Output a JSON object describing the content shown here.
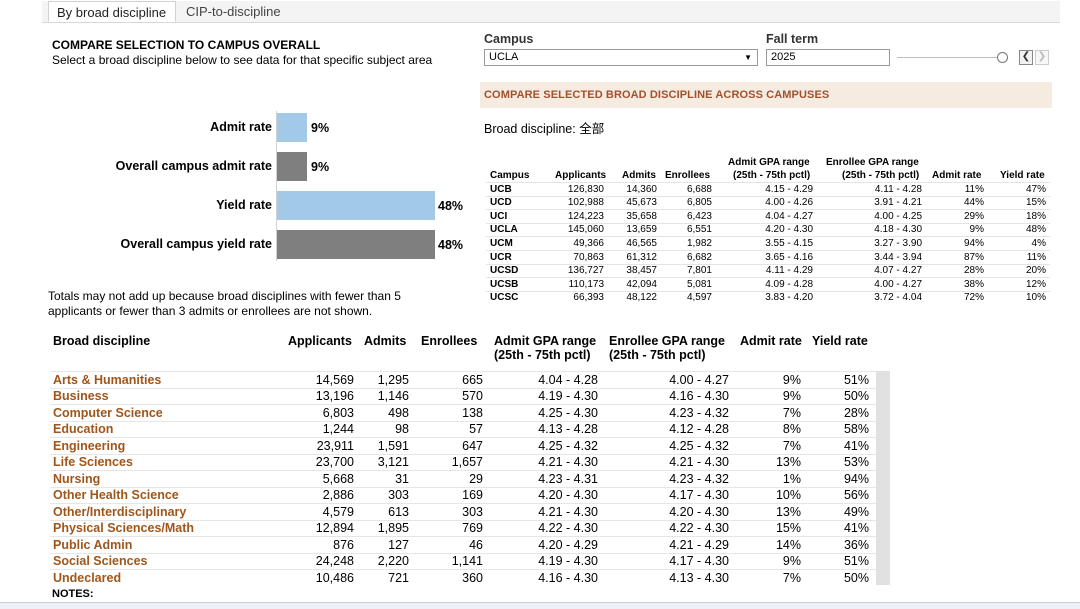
{
  "tabs": [
    {
      "label": "By broad discipline",
      "active": true
    },
    {
      "label": "CIP-to-discipline",
      "active": false
    }
  ],
  "compare": {
    "title": "COMPARE SELECTION TO CAMPUS OVERALL",
    "subtitle": "Select a broad discipline below to see data for that specific subject area",
    "bars": [
      {
        "label": "Admit rate",
        "value": 9,
        "display": "9%",
        "color": "#a3c9e8"
      },
      {
        "label": "Overall campus admit rate",
        "value": 9,
        "display": "9%",
        "color": "#7f7f7f"
      },
      {
        "label": "Yield rate",
        "value": 48,
        "display": "48%",
        "color": "#a3c9e8"
      },
      {
        "label": "Overall campus yield rate",
        "value": 48,
        "display": "48%",
        "color": "#7f7f7f"
      }
    ],
    "note": "Totals may not add up because broad disciplines with fewer than 5 applicants or fewer than 3 admits or enrollees are not shown."
  },
  "filters": {
    "campus_label": "Campus",
    "campus_value": "UCLA",
    "term_label": "Fall term",
    "term_value": "2025"
  },
  "campus_compare": {
    "title": "COMPARE SELECTED BROAD DISCIPLINE ACROSS CAMPUSES",
    "discipline_line": "Broad discipline: 全部",
    "headers": {
      "campus": "Campus",
      "applicants": "Applicants",
      "admits": "Admits",
      "enrollees": "Enrollees",
      "admit_gpa_1": "Admit GPA range",
      "admit_gpa_2": "(25th - 75th pctl)",
      "enrollee_gpa_1": "Enrollee GPA range",
      "enrollee_gpa_2": "(25th - 75th pctl)",
      "admit_rate": "Admit rate",
      "yield_rate": "Yield rate"
    },
    "rows": [
      [
        "UCB",
        "126,830",
        "14,360",
        "6,688",
        "4.15 - 4.29",
        "4.11 - 4.28",
        "11%",
        "47%"
      ],
      [
        "UCD",
        "102,988",
        "45,673",
        "6,805",
        "4.00 - 4.26",
        "3.91 - 4.21",
        "44%",
        "15%"
      ],
      [
        "UCI",
        "124,223",
        "35,658",
        "6,423",
        "4.04 - 4.27",
        "4.00 - 4.25",
        "29%",
        "18%"
      ],
      [
        "UCLA",
        "145,060",
        "13,659",
        "6,551",
        "4.20 - 4.30",
        "4.18 - 4.30",
        "9%",
        "48%"
      ],
      [
        "UCM",
        "49,366",
        "46,565",
        "1,982",
        "3.55 - 4.15",
        "3.27 - 3.90",
        "94%",
        "4%"
      ],
      [
        "UCR",
        "70,863",
        "61,312",
        "6,682",
        "3.65 - 4.16",
        "3.44 - 3.94",
        "87%",
        "11%"
      ],
      [
        "UCSD",
        "136,727",
        "38,457",
        "7,801",
        "4.11 - 4.29",
        "4.07 - 4.27",
        "28%",
        "20%"
      ],
      [
        "UCSB",
        "110,173",
        "42,094",
        "5,081",
        "4.09 - 4.28",
        "4.00 - 4.27",
        "38%",
        "12%"
      ],
      [
        "UCSC",
        "66,393",
        "48,122",
        "4,597",
        "3.83 - 4.20",
        "3.72 - 4.04",
        "72%",
        "10%"
      ]
    ]
  },
  "main_table": {
    "headers": {
      "discipline": "Broad discipline",
      "applicants": "Applicants",
      "admits": "Admits",
      "enrollees": "Enrollees",
      "admit_gpa_1": "Admit GPA range",
      "admit_gpa_2": "(25th - 75th pctl)",
      "enrollee_gpa_1": "Enrollee GPA range",
      "enrollee_gpa_2": "(25th - 75th pctl)",
      "admit_rate": "Admit rate",
      "yield_rate": "Yield rate"
    },
    "rows": [
      [
        "Arts & Humanities",
        "14,569",
        "1,295",
        "665",
        "4.04 - 4.28",
        "4.00 - 4.27",
        "9%",
        "51%"
      ],
      [
        "Business",
        "13,196",
        "1,146",
        "570",
        "4.19 - 4.30",
        "4.16 - 4.30",
        "9%",
        "50%"
      ],
      [
        "Computer Science",
        "6,803",
        "498",
        "138",
        "4.25 - 4.30",
        "4.23 - 4.32",
        "7%",
        "28%"
      ],
      [
        "Education",
        "1,244",
        "98",
        "57",
        "4.13 - 4.28",
        "4.12 - 4.28",
        "8%",
        "58%"
      ],
      [
        "Engineering",
        "23,911",
        "1,591",
        "647",
        "4.25 - 4.32",
        "4.25 - 4.32",
        "7%",
        "41%"
      ],
      [
        "Life Sciences",
        "23,700",
        "3,121",
        "1,657",
        "4.21 - 4.30",
        "4.21 - 4.30",
        "13%",
        "53%"
      ],
      [
        "Nursing",
        "5,668",
        "31",
        "29",
        "4.23 - 4.31",
        "4.23 - 4.32",
        "1%",
        "94%"
      ],
      [
        "Other Health Science",
        "2,886",
        "303",
        "169",
        "4.20 - 4.30",
        "4.17 - 4.30",
        "10%",
        "56%"
      ],
      [
        "Other/Interdisciplinary",
        "4,579",
        "613",
        "303",
        "4.21 - 4.30",
        "4.20 - 4.30",
        "13%",
        "49%"
      ],
      [
        "Physical Sciences/Math",
        "12,894",
        "1,895",
        "769",
        "4.22 - 4.30",
        "4.22 - 4.30",
        "15%",
        "41%"
      ],
      [
        "Public Admin",
        "876",
        "127",
        "46",
        "4.20 - 4.29",
        "4.21 - 4.29",
        "14%",
        "36%"
      ],
      [
        "Social Sciences",
        "24,248",
        "2,220",
        "1,141",
        "4.19 - 4.30",
        "4.17 - 4.30",
        "9%",
        "51%"
      ],
      [
        "Undeclared",
        "10,486",
        "721",
        "360",
        "4.16 - 4.30",
        "4.13 - 4.30",
        "7%",
        "50%"
      ]
    ],
    "notes_label": "NOTES:"
  }
}
